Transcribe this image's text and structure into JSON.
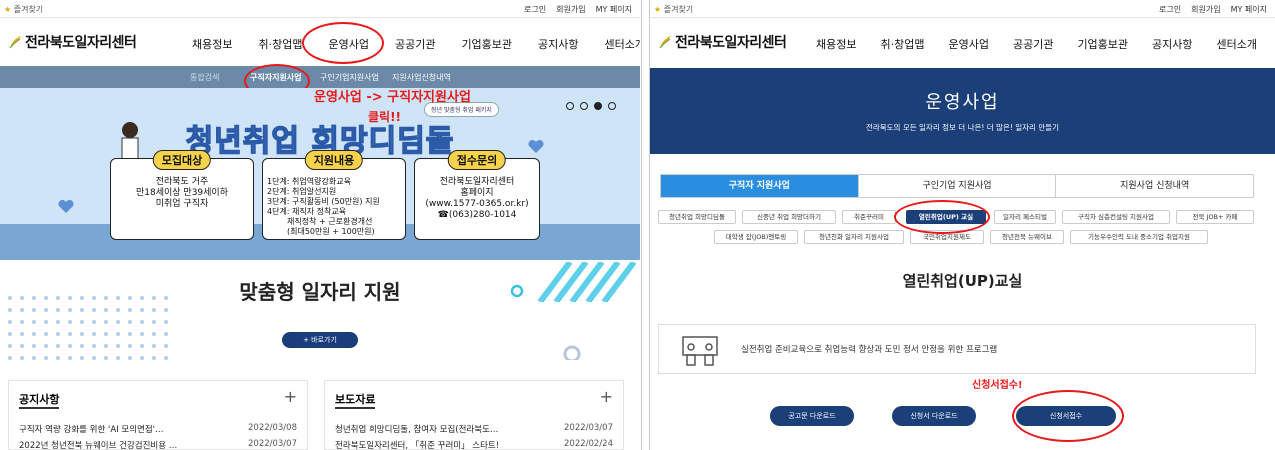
{
  "left": {
    "topbar": {
      "favorite": "즐겨찾기",
      "util": [
        "로그인",
        "회원가입",
        "MY 페이지"
      ]
    },
    "logo": "전라북도일자리센터",
    "gnb": [
      "채용정보",
      "취·창업맵",
      "운영사업",
      "공공기관",
      "기업홍보관",
      "공지사항",
      "센터소개"
    ],
    "subnav": {
      "left": "통합검색",
      "items": [
        "구직자지원사업",
        "구인기업지원사업",
        "지원사업신청내역"
      ]
    },
    "annotation1": "운영사업 -> 구직자지원사업",
    "annotation2": "클릭!!",
    "hero": {
      "pill": "청년 맞춤형 취업 패키지",
      "title": "청년취업 희망디딤돌",
      "cards": [
        {
          "head": "모집대상",
          "body": [
            "전라북도 거주",
            "만18세이상 만39세이하",
            "미취업 구직자"
          ]
        },
        {
          "head": "지원내용",
          "body": [
            "1단계: 취업역량강화교육",
            "2단계: 취업알선지원",
            "3단계: 구직활동비 (50만원) 지원",
            "4단계: 재직자 정착교육",
            "재직정착 + 근로환경개선",
            "(최대50만원 + 100만원)"
          ]
        },
        {
          "head": "접수문의",
          "body": [
            "전라북도일자리센터",
            "홈페이지",
            "(www.1577-0365.or.kr)",
            "☎(063)280-1014"
          ]
        }
      ]
    },
    "section_title": "맞춤형 일자리 지원",
    "go_button": "+ 바로가기",
    "notice": {
      "title": "공지사항",
      "plus": "+",
      "rows": [
        {
          "text": "구직자 역량 강화를 위한 'AI 모의면접'…",
          "date": "2022/03/08"
        },
        {
          "text": "2022년 청년전북 뉴웨이브 건강검진비용 …",
          "date": "2022/03/07"
        }
      ]
    },
    "press": {
      "title": "보도자료",
      "plus": "+",
      "rows": [
        {
          "text": "청년취업 희망디딤돌, 참여자 모집(전라북도…",
          "date": "2022/03/07"
        },
        {
          "text": "전라북도일자리센터, 「취준 꾸러미」 스타트!",
          "date": "2022/02/24"
        }
      ]
    }
  },
  "right": {
    "topbar": {
      "favorite": "즐겨찾기",
      "util": [
        "로그인",
        "회원가입",
        "MY 페이지"
      ]
    },
    "logo": "전라북도일자리센터",
    "gnb": [
      "채용정보",
      "취·창업맵",
      "운영사업",
      "공공기관",
      "기업홍보관",
      "공지사항",
      "센터소개"
    ],
    "banner": {
      "title": "운영사업",
      "subtitle": "전라북도의 모든 일자리 정보 더 나은! 더 많은! 일자리 만들기"
    },
    "tabs": [
      "구직자 지원사업",
      "구인기업 지원사업",
      "지원사업 신청내역"
    ],
    "chips_row1": [
      "청년취업 희망디딤돌",
      "신중년 취업 희망더하기",
      "취준꾸러미",
      "열린취업(UP) 교실",
      "일자리 페스티벌",
      "구직자 심층컨설팅 지원사업",
      "전북 JOB+ 카페"
    ],
    "chips_row2": [
      "대학생 잡(JOB)멘토링",
      "청년친화 일자리 지원사업",
      "국민취업지원제도",
      "청년전북 뉴웨이브",
      "기능우수인력 도내 중소기업 취업지원"
    ],
    "section_title": "열린취업(UP)교실",
    "info_text": "실전취업 준비교육으로 취업능력 향상과 도민 정서 안정을 위한 프로그램",
    "annotation": "신청서접수!",
    "buttons": [
      "공고문 다운로드",
      "신청서 다운로드",
      "신청서접수"
    ]
  },
  "colors": {
    "annotation_red": "#e8191a",
    "navy": "#1b3f78",
    "tab_blue": "#2a8ee0"
  }
}
